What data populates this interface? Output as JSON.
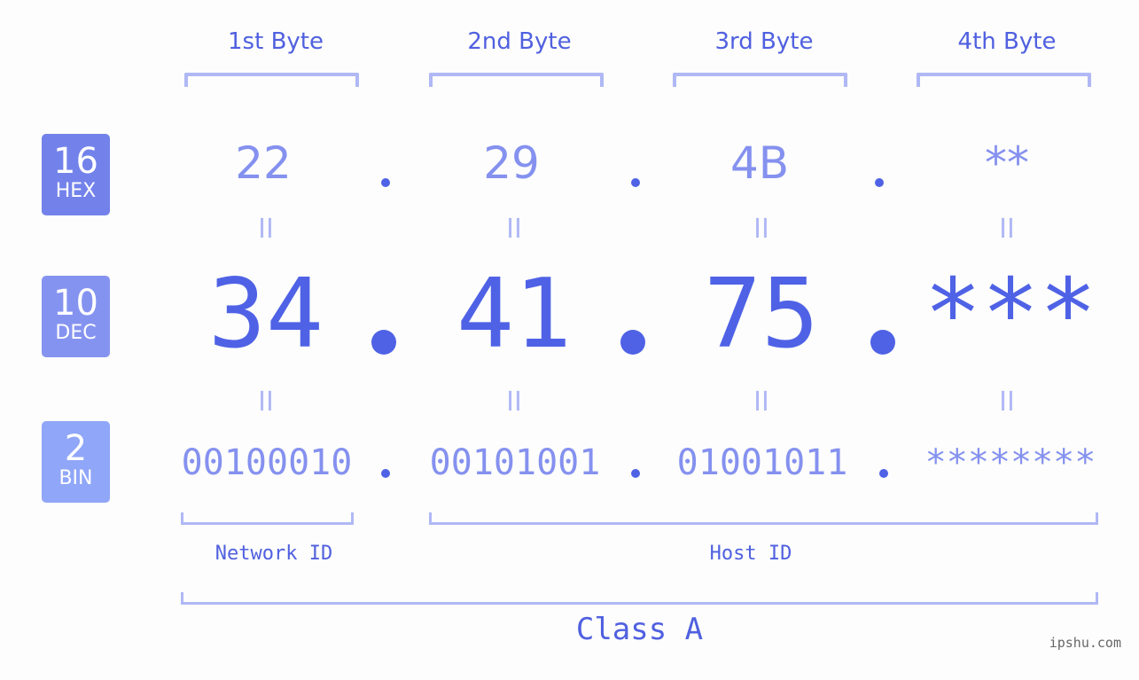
{
  "badges": [
    {
      "num": "16",
      "label": "HEX",
      "color": "#7382ea"
    },
    {
      "num": "10",
      "label": "DEC",
      "color": "#8593f0"
    },
    {
      "num": "2",
      "label": "BIN",
      "color": "#90a6f8"
    }
  ],
  "byte_headers": [
    "1st Byte",
    "2nd Byte",
    "3rd Byte",
    "4th Byte"
  ],
  "hex": [
    "22",
    "29",
    "4B",
    "**"
  ],
  "dec": [
    "34",
    "41",
    "75",
    "***"
  ],
  "bin": [
    "00100010",
    "00101001",
    "01001011",
    "********"
  ],
  "equals_symbol": "II",
  "network_id_label": "Network ID",
  "host_id_label": "Host ID",
  "class_label": "Class A",
  "watermark": "ipshu.com",
  "colors": {
    "accent": "#4f62e6",
    "light": "#8591ef",
    "bracket": "#b0b8f5"
  }
}
